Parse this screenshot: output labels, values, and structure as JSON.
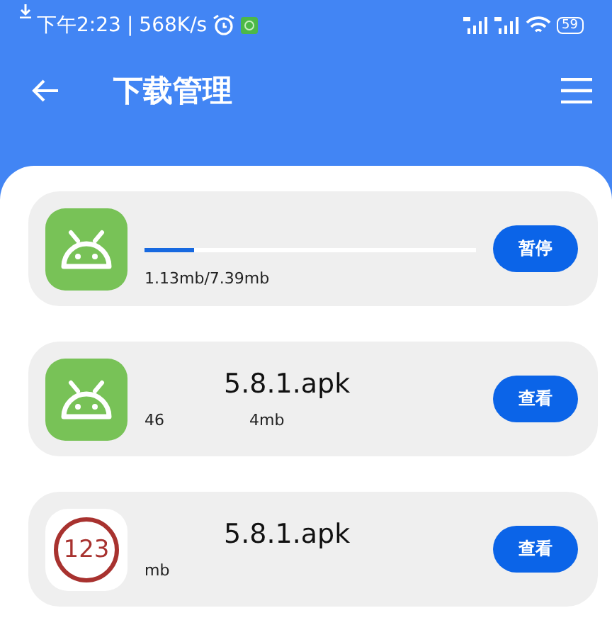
{
  "status_bar": {
    "time": "下午2:23",
    "separator": "|",
    "speed": "568K/s",
    "battery": "59"
  },
  "header": {
    "title": "下载管理"
  },
  "downloads": [
    {
      "kind": "downloading",
      "level": 0.15,
      "size_parts": [
        "1.13mb/7.39mb"
      ],
      "button": "暂停"
    },
    {
      "kind": "done",
      "name_parts": [
        "5.8.1.apk"
      ],
      "size_parts": [
        "46",
        "4mb"
      ],
      "button": "查看"
    },
    {
      "kind": "done",
      "icon_text": "123",
      "name_parts": [
        "5.8.1.apk"
      ],
      "size_parts": [
        "mb"
      ],
      "button": "查看"
    }
  ]
}
